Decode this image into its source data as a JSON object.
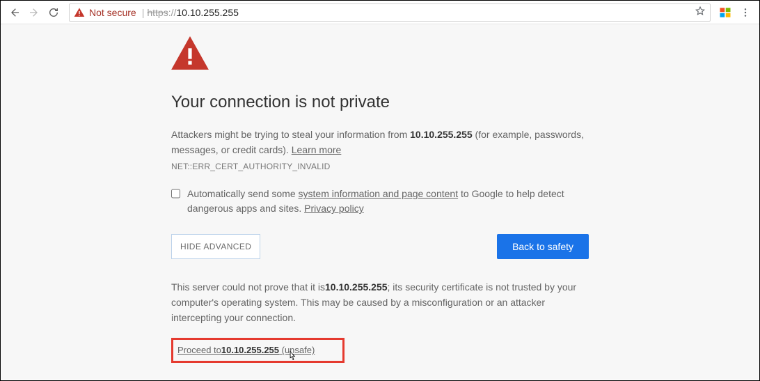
{
  "toolbar": {
    "security_label": "Not secure",
    "url_scheme": "https",
    "url_sep": "://",
    "url_host": "10.10.255.255"
  },
  "warning": {
    "title": "Your connection is not private",
    "p1a": "Attackers might be trying to steal your information from ",
    "p1_host": "10.10.255.255",
    "p1b": " (for example, passwords, messages, or credit cards). ",
    "learn_more": "Learn more",
    "error_code": "NET::ERR_CERT_AUTHORITY_INVALID",
    "opt_a": "Automatically send some ",
    "opt_link1": "system information and page content",
    "opt_b": " to Google to help detect dangerous apps and sites. ",
    "opt_link2": "Privacy policy",
    "hide_adv": "HIDE ADVANCED",
    "back_safety": "Back to safety",
    "adv_a": "This server could not prove that it is",
    "adv_host": "10.10.255.255",
    "adv_b": "; its security certificate is not trusted by your computer's operating system. This may be caused by a misconfiguration or an attacker intercepting your connection.",
    "proceed_a": "Proceed to",
    "proceed_host": "10.10.255.255",
    "proceed_b": " (unsafe)"
  }
}
